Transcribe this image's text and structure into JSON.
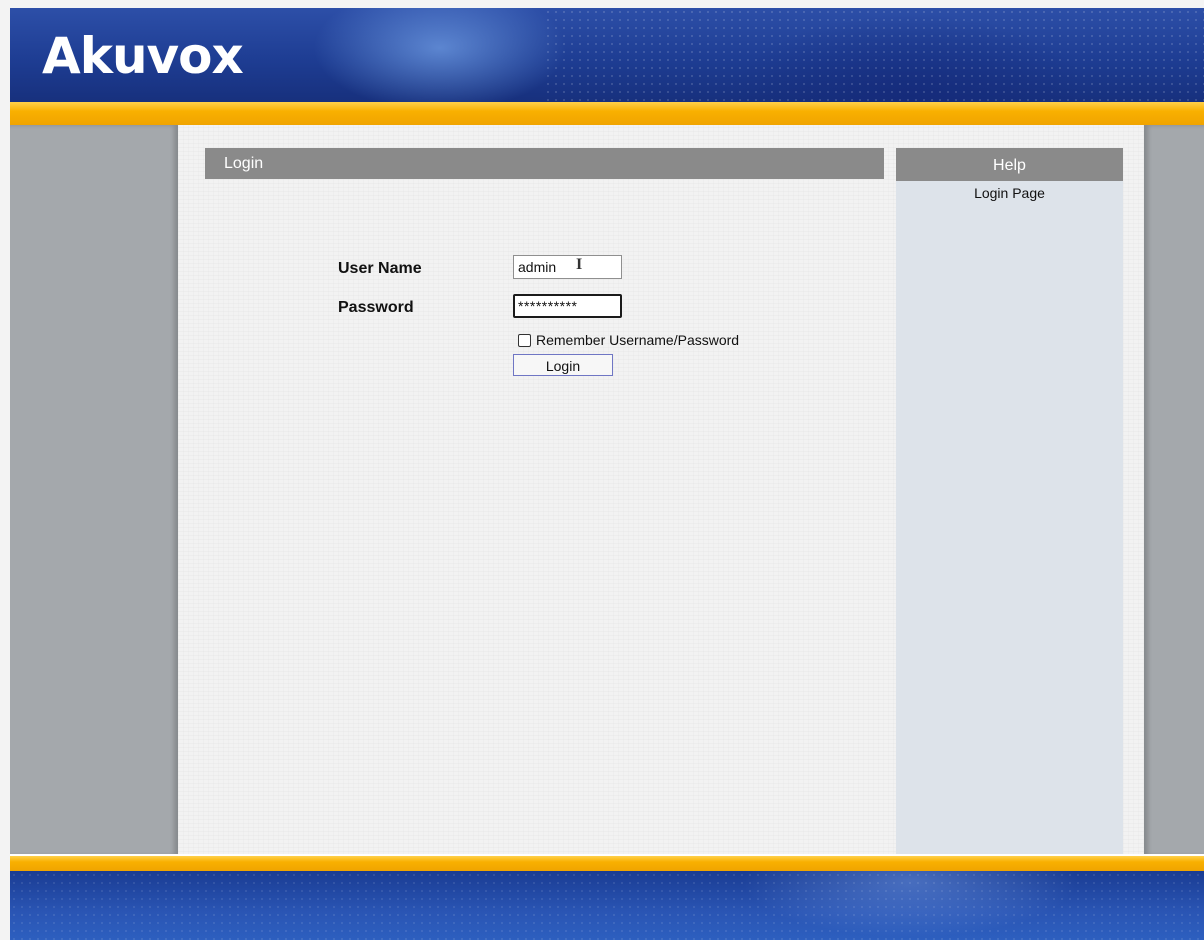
{
  "brand": {
    "logo_text": "Akuvox"
  },
  "colors": {
    "header_blue": "#1e3d93",
    "accent_gold": "#f9b000",
    "bar_gray": "#8a8a8a",
    "help_bg": "#dde3ea",
    "side_gray": "#a4a8ac"
  },
  "login_panel": {
    "title": "Login",
    "username_label": "User Name",
    "username_value": "admin",
    "password_label": "Password",
    "password_value": "**********",
    "remember_label": "Remember Username/Password",
    "remember_checked": false,
    "login_button": "Login"
  },
  "help_panel": {
    "title": "Help",
    "text": "Login Page"
  },
  "cursor": {
    "icon": "text-cursor-icon",
    "glyph": "I"
  }
}
